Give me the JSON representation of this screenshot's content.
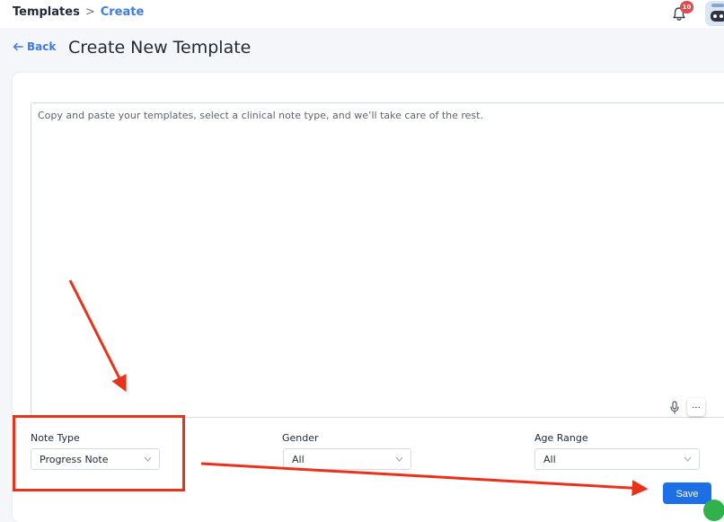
{
  "breadcrumb": {
    "root": "Templates",
    "separator": ">",
    "current": "Create"
  },
  "header": {
    "notification_count": "10"
  },
  "page": {
    "back_label": "Back",
    "title": "Create New Template"
  },
  "editor": {
    "placeholder": "Copy and paste your templates, select a clinical note type, and we’ll take care of the rest.",
    "more_label": "..."
  },
  "fields": {
    "note_type": {
      "label": "Note Type",
      "value": "Progress Note"
    },
    "gender": {
      "label": "Gender",
      "value": "All"
    },
    "age_range": {
      "label": "Age Range",
      "value": "All"
    }
  },
  "actions": {
    "save_label": "Save"
  },
  "colors": {
    "accent": "#3f7be0",
    "primary_button": "#1d6fe6",
    "annotation": "#e8321c",
    "badge": "#e5484d"
  },
  "icons": [
    "bell-icon",
    "back-arrow-icon",
    "microphone-icon",
    "chevron-down-icon"
  ]
}
